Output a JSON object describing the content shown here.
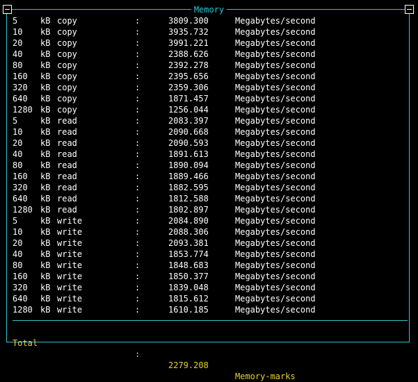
{
  "window": {
    "title": "Memory"
  },
  "results": [
    {
      "size": "5",
      "unit": "kB",
      "op": "copy",
      "colon": ":",
      "value": "3809.300",
      "units": "Megabytes/second"
    },
    {
      "size": "10",
      "unit": "kB",
      "op": "copy",
      "colon": ":",
      "value": "3935.732",
      "units": "Megabytes/second"
    },
    {
      "size": "20",
      "unit": "kB",
      "op": "copy",
      "colon": ":",
      "value": "3991.221",
      "units": "Megabytes/second"
    },
    {
      "size": "40",
      "unit": "kB",
      "op": "copy",
      "colon": ":",
      "value": "2388.626",
      "units": "Megabytes/second"
    },
    {
      "size": "80",
      "unit": "kB",
      "op": "copy",
      "colon": ":",
      "value": "2392.278",
      "units": "Megabytes/second"
    },
    {
      "size": "160",
      "unit": "kB",
      "op": "copy",
      "colon": ":",
      "value": "2395.656",
      "units": "Megabytes/second"
    },
    {
      "size": "320",
      "unit": "kB",
      "op": "copy",
      "colon": ":",
      "value": "2359.306",
      "units": "Megabytes/second"
    },
    {
      "size": "640",
      "unit": "kB",
      "op": "copy",
      "colon": ":",
      "value": "1871.457",
      "units": "Megabytes/second"
    },
    {
      "size": "1280",
      "unit": "kB",
      "op": "copy",
      "colon": ":",
      "value": "1256.044",
      "units": "Megabytes/second"
    },
    {
      "size": "5",
      "unit": "kB",
      "op": "read",
      "colon": ":",
      "value": "2083.397",
      "units": "Megabytes/second"
    },
    {
      "size": "10",
      "unit": "kB",
      "op": "read",
      "colon": ":",
      "value": "2090.668",
      "units": "Megabytes/second"
    },
    {
      "size": "20",
      "unit": "kB",
      "op": "read",
      "colon": ":",
      "value": "2090.593",
      "units": "Megabytes/second"
    },
    {
      "size": "40",
      "unit": "kB",
      "op": "read",
      "colon": ":",
      "value": "1891.613",
      "units": "Megabytes/second"
    },
    {
      "size": "80",
      "unit": "kB",
      "op": "read",
      "colon": ":",
      "value": "1890.094",
      "units": "Megabytes/second"
    },
    {
      "size": "160",
      "unit": "kB",
      "op": "read",
      "colon": ":",
      "value": "1889.466",
      "units": "Megabytes/second"
    },
    {
      "size": "320",
      "unit": "kB",
      "op": "read",
      "colon": ":",
      "value": "1882.595",
      "units": "Megabytes/second"
    },
    {
      "size": "640",
      "unit": "kB",
      "op": "read",
      "colon": ":",
      "value": "1812.588",
      "units": "Megabytes/second"
    },
    {
      "size": "1280",
      "unit": "kB",
      "op": "read",
      "colon": ":",
      "value": "1802.897",
      "units": "Megabytes/second"
    },
    {
      "size": "5",
      "unit": "kB",
      "op": "write",
      "colon": ":",
      "value": "2084.890",
      "units": "Megabytes/second"
    },
    {
      "size": "10",
      "unit": "kB",
      "op": "write",
      "colon": ":",
      "value": "2088.306",
      "units": "Megabytes/second"
    },
    {
      "size": "20",
      "unit": "kB",
      "op": "write",
      "colon": ":",
      "value": "2093.381",
      "units": "Megabytes/second"
    },
    {
      "size": "40",
      "unit": "kB",
      "op": "write",
      "colon": ":",
      "value": "1853.774",
      "units": "Megabytes/second"
    },
    {
      "size": "80",
      "unit": "kB",
      "op": "write",
      "colon": ":",
      "value": "1848.683",
      "units": "Megabytes/second"
    },
    {
      "size": "160",
      "unit": "kB",
      "op": "write",
      "colon": ":",
      "value": "1850.377",
      "units": "Megabytes/second"
    },
    {
      "size": "320",
      "unit": "kB",
      "op": "write",
      "colon": ":",
      "value": "1839.048",
      "units": "Megabytes/second"
    },
    {
      "size": "640",
      "unit": "kB",
      "op": "write",
      "colon": ":",
      "value": "1815.612",
      "units": "Megabytes/second"
    },
    {
      "size": "1280",
      "unit": "kB",
      "op": "write",
      "colon": ":",
      "value": "1610.185",
      "units": "Megabytes/second"
    }
  ],
  "total": {
    "label": "Total",
    "colon": ":",
    "value": "2279.208",
    "units": "Memory-marks"
  },
  "colors": {
    "border": "#2ec6d6",
    "text": "#ffffff",
    "total": "#e7d32a",
    "background": "#000000"
  }
}
